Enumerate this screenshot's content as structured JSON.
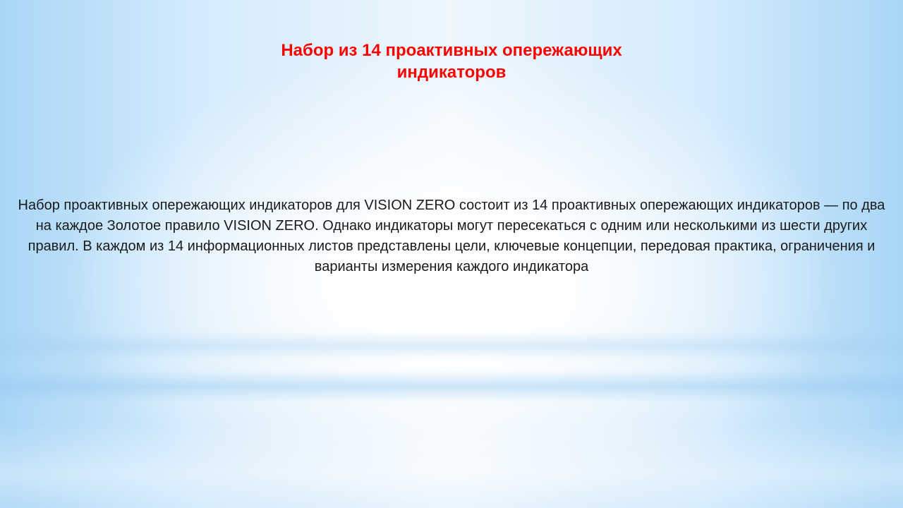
{
  "slide": {
    "title": "Набор из 14 проактивных опережающих индикаторов",
    "body": "Набор проактивных опережающих индикаторов для VISION ZERO состоит из 14 проактивных опережающих индикаторов — по два на каждое Золотое правило VISION ZERO. Однако индикаторы могут пересекаться с одним или несколькими из шести других правил. В каждом из 14 информационных листов представлены цели, ключевые концепции, передовая практика, ограничения и варианты измерения каждого индикатора"
  },
  "colors": {
    "title": "#ff0000",
    "body_text": "#1a1a1a",
    "background_center": "#ffffff",
    "background_edge": "#a9d6f7"
  }
}
